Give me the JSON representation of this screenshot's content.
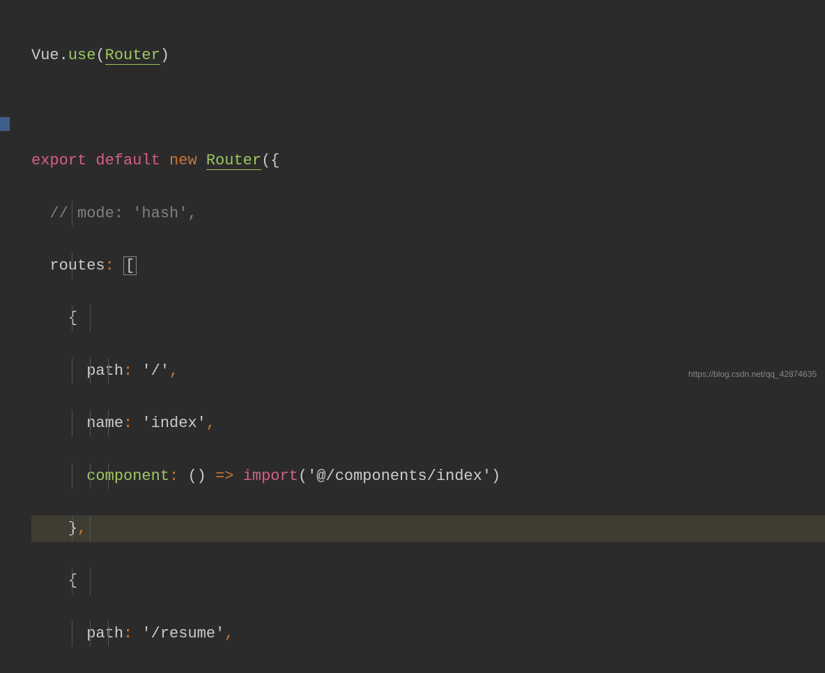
{
  "code": {
    "line1": {
      "vue": "Vue",
      "dot": ".",
      "use": "use",
      "lparen": "(",
      "router": "Router",
      "rparen": ")"
    },
    "line2": "",
    "line3": {
      "export": "export",
      "default": "default",
      "new": "new",
      "router": "Router",
      "lparen": "(",
      "lbrace": "{"
    },
    "line4": {
      "comment": "// mode: 'hash',"
    },
    "line5": {
      "routes": "routes",
      "colon": ":",
      "bracket": "["
    },
    "line6": {
      "lbrace": "{"
    },
    "line7": {
      "path": "path",
      "colon": ":",
      "value": "'/'",
      "comma": ","
    },
    "line8": {
      "name": "name",
      "colon": ":",
      "value": "'index'",
      "comma": ","
    },
    "line9": {
      "component": "component",
      "colon": ":",
      "parens": "()",
      "arrow": "=>",
      "import": "import",
      "lparen": "(",
      "value": "'@/components/index'",
      "rparen": ")"
    },
    "line10": {
      "rbrace": "}",
      "comma": ","
    },
    "line11": {
      "lbrace": "{"
    },
    "line12": {
      "path": "path",
      "colon": ":",
      "value": "'/resume'",
      "comma": ","
    }
  },
  "watermark": "https://blog.csdn.net/qq_42874635"
}
